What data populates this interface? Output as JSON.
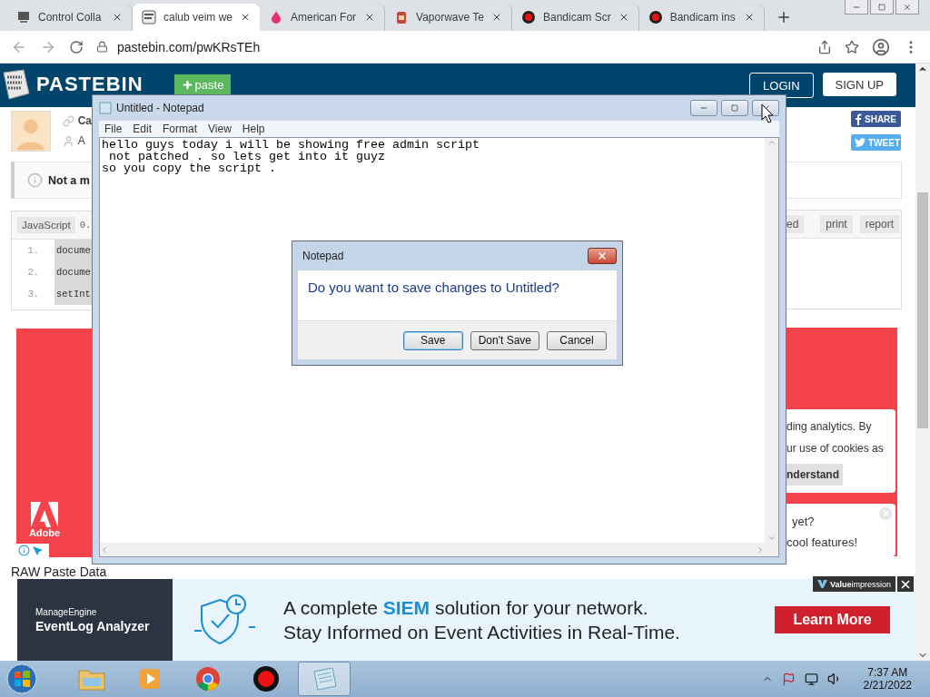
{
  "browser": {
    "tabs": [
      {
        "title": "Control Colla",
        "kind": "gear",
        "selected": false
      },
      {
        "title": "calub veim we",
        "kind": "binary",
        "selected": true
      },
      {
        "title": "American For",
        "kind": "flame",
        "selected": false
      },
      {
        "title": "Vaporwave Te",
        "kind": "jar",
        "selected": false
      },
      {
        "title": "Bandicam Scr",
        "kind": "record",
        "selected": false
      },
      {
        "title": "Bandicam ins",
        "kind": "record",
        "selected": false
      }
    ],
    "address": "pastebin.com/pwKRsTEh"
  },
  "pastebin": {
    "logo": "PASTEBIN",
    "paste_button": "paste",
    "login": "LOGIN",
    "signup": "SIGN UP",
    "share": "SHARE",
    "tweet": "TWEET",
    "title_fragment": "Ca",
    "author_fragment": "A",
    "notice_fragment": "Not a m",
    "syntax": "JavaScript",
    "size_fragment": "0.",
    "toolbar": [
      "ed",
      "print",
      "report"
    ],
    "code_lines": [
      {
        "number": "1.",
        "code": "docume"
      },
      {
        "number": "2.",
        "code": "docume"
      },
      {
        "number": "3.",
        "code": "setInt"
      }
    ],
    "ad_brand": "Adobe",
    "cookie": {
      "lines": [
        "ding analytics. By",
        "ur use of cookies as"
      ],
      "button": "nderstand"
    },
    "promo": {
      "lines": [
        "yet?",
        "cool features!"
      ]
    },
    "raw_heading": "RAW Paste Data"
  },
  "ad_banner": {
    "brand_top": "ManageEngine",
    "product": "EventLog Analyzer",
    "headline": "A complete **SIEM** solution for your network.",
    "subline": "Stay Informed on Event Activities in Real-Time.",
    "cta": "Learn More",
    "network": "**Value**impression"
  },
  "notepad": {
    "title": "Untitled - Notepad",
    "menu": [
      "File",
      "Edit",
      "Format",
      "View",
      "Help"
    ],
    "text": "hello guys today i will be showing free admin script\n not patched . so lets get into it guyz\nso you copy the script ."
  },
  "dialog": {
    "title": "Notepad",
    "message": "Do you want to save changes to Untitled?",
    "buttons": [
      {
        "label": "Save",
        "selected": true
      },
      {
        "label": "Don't Save",
        "selected": false
      },
      {
        "label": "Cancel",
        "selected": false
      }
    ]
  },
  "taskbar": {
    "apps": [
      {
        "kind": "explorer",
        "active": false
      },
      {
        "kind": "media",
        "active": false
      },
      {
        "kind": "chrome",
        "active": false
      },
      {
        "kind": "record",
        "active": false
      },
      {
        "kind": "notepad",
        "active": true
      }
    ],
    "time": "7:37 AM",
    "date": "2/21/2022"
  }
}
